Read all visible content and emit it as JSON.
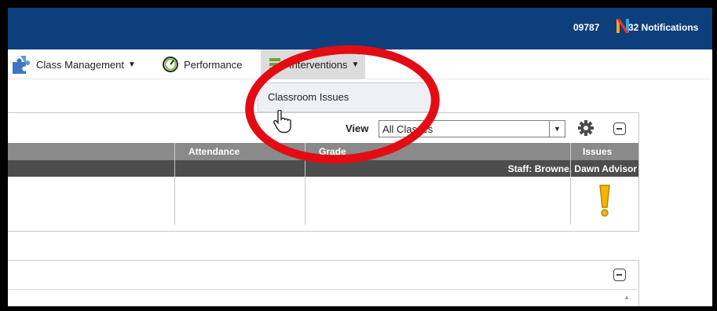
{
  "topbar": {
    "account_id": "09787",
    "notifications_label": "32 Notifications",
    "logo_letter": "N",
    "color": "#0d3f7c"
  },
  "nav": {
    "class_management": "Class Management",
    "performance": "Performance",
    "interventions": "Interventions"
  },
  "dropdown": {
    "items": [
      "Classroom Issues"
    ]
  },
  "panel": {
    "view_label": "View",
    "view_selected": "All Classes",
    "columns": {
      "attendance": "Attendance",
      "grade": "Grade",
      "issues": "Issues"
    },
    "group_label": "Staff: Browne, Dawn Advisor",
    "issue_icon": "exclamation-icon"
  },
  "overlay": {
    "ring_color": "#e40c14"
  }
}
